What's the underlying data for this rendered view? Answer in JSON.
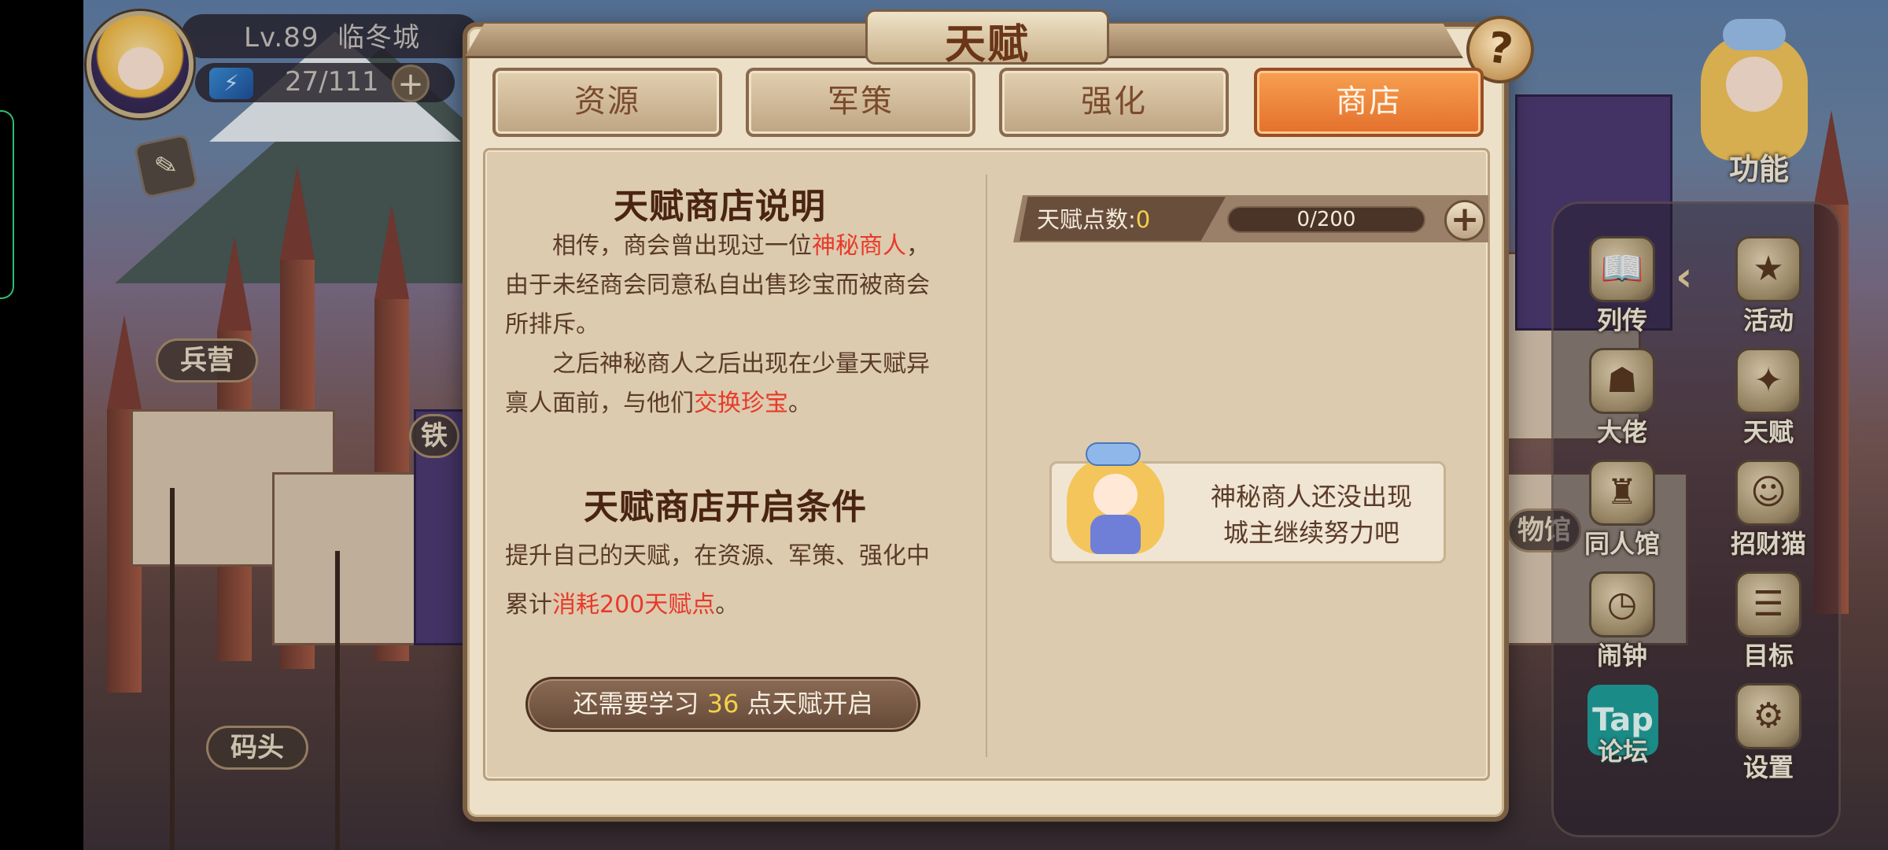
{
  "player": {
    "level_text": "Lv.89",
    "city": "临冬城",
    "energy": "27/111",
    "energy_plus": "+"
  },
  "map_labels": {
    "barracks": "兵营",
    "dock": "码头",
    "partial_left": "铁",
    "partial_right": "物馆"
  },
  "sidebar": {
    "function_label": "功能",
    "items": [
      {
        "label": "列传",
        "icon": "book-icon"
      },
      {
        "label": "活动",
        "icon": "star-medal-icon"
      },
      {
        "label": "大佬",
        "icon": "boss-icon"
      },
      {
        "label": "天赋",
        "icon": "talent-crest-icon"
      },
      {
        "label": "同人馆",
        "icon": "castle-icon"
      },
      {
        "label": "招财猫",
        "icon": "lucky-cat-icon"
      },
      {
        "label": "闹钟",
        "icon": "alarm-clock-icon"
      },
      {
        "label": "目标",
        "icon": "target-scroll-icon"
      },
      {
        "label": "论坛",
        "icon": "tap-forum-icon"
      },
      {
        "label": "设置",
        "icon": "gear-icon"
      }
    ],
    "tap_logo": "Tap"
  },
  "modal": {
    "title": "天赋",
    "help_label": "?",
    "tabs": [
      {
        "label": "资源",
        "active": false
      },
      {
        "label": "军策",
        "active": false
      },
      {
        "label": "强化",
        "active": false
      },
      {
        "label": "商店",
        "active": true
      }
    ],
    "shop_intro": {
      "title": "天赋商店说明",
      "p1_a": "相传，商会曾出现过一位",
      "p1_hl": "神秘商人",
      "p1_b": "，",
      "p1_line2": "由于未经商会同意私自出售珍宝而被商会",
      "p1_line3": "所排斥。",
      "p2_a": "之后神秘商人之后出现在少量天赋异",
      "p2_line2_a": "禀人面前，与他们",
      "p2_hl": "交换珍宝",
      "p2_line2_b": "。"
    },
    "open_condition": {
      "title": "天赋商店开启条件",
      "line1": "提升自己的天赋，在资源、军策、强化中",
      "line2_a": "累计",
      "line2_hl": "消耗200天赋点",
      "line2_b": "。"
    },
    "unlock_button": {
      "prefix": "还需要学习 ",
      "points": "36",
      "suffix": " 点天赋开启"
    },
    "points": {
      "label": "天赋点数:",
      "value": "0",
      "progress_text": "0/200",
      "progress_fraction": 0,
      "plus": "+"
    },
    "merchant": {
      "line1": "神秘商人还没出现",
      "line2": "城主继续努力吧"
    }
  },
  "colors": {
    "highlight_red": "#e83a2a",
    "active_tab": "#e4702c",
    "number_yellow": "#f3d24a"
  }
}
